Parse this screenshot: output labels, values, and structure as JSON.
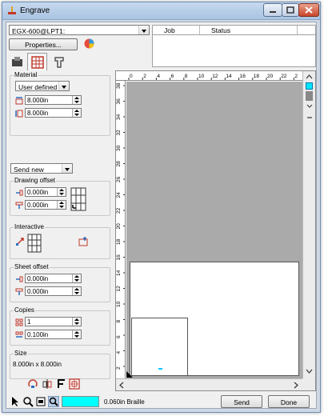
{
  "window": {
    "title": "Engrave",
    "accent": "#00ffff",
    "close_color": "#c9462a"
  },
  "top": {
    "printer_combo": "EGX-600@LPT1:",
    "properties_label": "Properties...",
    "job_header": [
      "Job",
      "Status"
    ]
  },
  "tabs": [
    {
      "icon": "engrave-tool-icon"
    },
    {
      "icon": "layout-grid-icon"
    },
    {
      "icon": "fixture-icon"
    }
  ],
  "material": {
    "group_label": "Material",
    "type_value": "User defined",
    "width_value": "8.000in",
    "height_value": "8.000in"
  },
  "send_combo": "Send new",
  "drawing_offset": {
    "group_label": "Drawing offset",
    "x_value": "0.000in",
    "y_value": "0.000in"
  },
  "interactive": {
    "group_label": "Interactive"
  },
  "sheet_offset": {
    "group_label": "Sheet offset",
    "x_value": "0.000in",
    "y_value": "0.000in"
  },
  "copies": {
    "group_label": "Copies",
    "count_value": "1",
    "spacing_value": "0.100in"
  },
  "size": {
    "group_label": "Size",
    "value": "8.000in x 8.000in"
  },
  "ruler": {
    "h_ticks": [
      "0",
      "2",
      "4",
      "6",
      "8",
      "10",
      "12",
      "14",
      "16",
      "18",
      "20",
      "22",
      "2"
    ],
    "v_ticks": [
      "38",
      "36",
      "34",
      "32",
      "30",
      "28",
      "26",
      "24",
      "22",
      "20",
      "18",
      "16",
      "14",
      "12",
      "10",
      "8",
      "6",
      "4",
      "2"
    ]
  },
  "status": {
    "tool_text": "0.060in Braille",
    "send_label": "Send",
    "done_label": "Done",
    "swatch_color": "#00ffff"
  }
}
